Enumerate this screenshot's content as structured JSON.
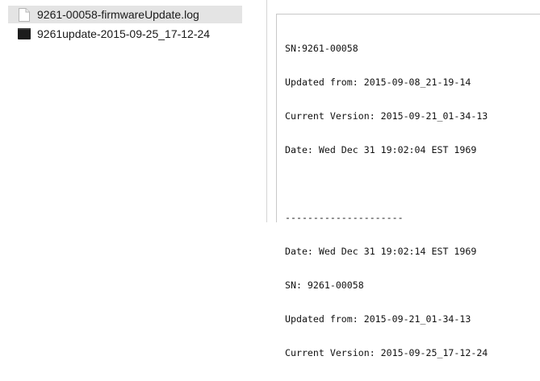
{
  "files": [
    {
      "name": "9261-00058-firmwareUpdate.log",
      "icon": "document-icon",
      "selected": true
    },
    {
      "name": "9261update-2015-09-25_17-12-24",
      "icon": "executable-icon",
      "selected": false
    }
  ],
  "preview": {
    "lines": [
      "SN:9261-00058",
      "Updated from: 2015-09-08_21-19-14",
      "Current Version: 2015-09-21_01-34-13",
      "Date: Wed Dec 31 19:02:04 EST 1969",
      "",
      "---------------------",
      "Date: Wed Dec 31 19:02:14 EST 1969",
      "SN: 9261-00058",
      "Updated from: 2015-09-21_01-34-13",
      "Current Version: 2015-09-25_17-12-24"
    ]
  }
}
